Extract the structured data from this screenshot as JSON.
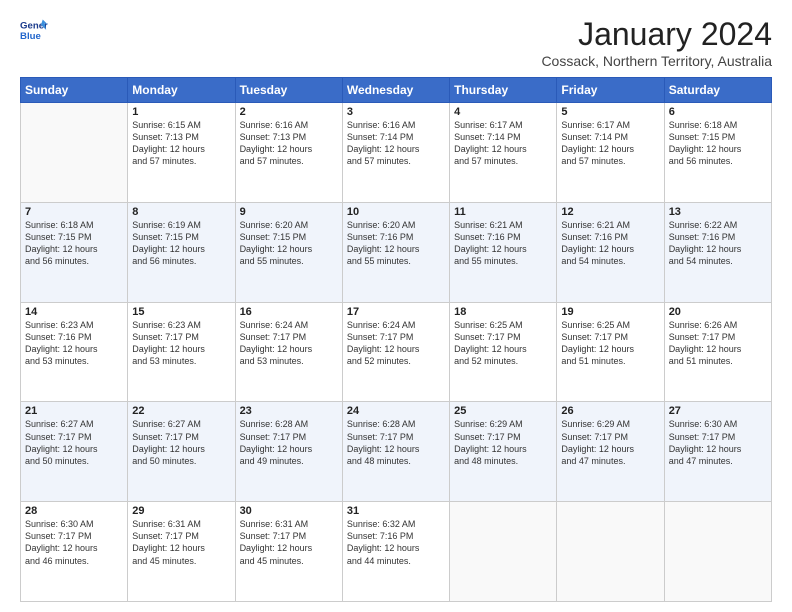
{
  "header": {
    "logo_line1": "General",
    "logo_line2": "Blue",
    "month_title": "January 2024",
    "subtitle": "Cossack, Northern Territory, Australia"
  },
  "weekdays": [
    "Sunday",
    "Monday",
    "Tuesday",
    "Wednesday",
    "Thursday",
    "Friday",
    "Saturday"
  ],
  "weeks": [
    [
      {
        "day": "",
        "sunrise": "",
        "sunset": "",
        "daylight": ""
      },
      {
        "day": "1",
        "sunrise": "6:15 AM",
        "sunset": "7:13 PM",
        "daylight": "12 hours and 57 minutes."
      },
      {
        "day": "2",
        "sunrise": "6:16 AM",
        "sunset": "7:13 PM",
        "daylight": "12 hours and 57 minutes."
      },
      {
        "day": "3",
        "sunrise": "6:16 AM",
        "sunset": "7:14 PM",
        "daylight": "12 hours and 57 minutes."
      },
      {
        "day": "4",
        "sunrise": "6:17 AM",
        "sunset": "7:14 PM",
        "daylight": "12 hours and 57 minutes."
      },
      {
        "day": "5",
        "sunrise": "6:17 AM",
        "sunset": "7:14 PM",
        "daylight": "12 hours and 57 minutes."
      },
      {
        "day": "6",
        "sunrise": "6:18 AM",
        "sunset": "7:15 PM",
        "daylight": "12 hours and 56 minutes."
      }
    ],
    [
      {
        "day": "7",
        "sunrise": "6:18 AM",
        "sunset": "7:15 PM",
        "daylight": "12 hours and 56 minutes."
      },
      {
        "day": "8",
        "sunrise": "6:19 AM",
        "sunset": "7:15 PM",
        "daylight": "12 hours and 56 minutes."
      },
      {
        "day": "9",
        "sunrise": "6:20 AM",
        "sunset": "7:15 PM",
        "daylight": "12 hours and 55 minutes."
      },
      {
        "day": "10",
        "sunrise": "6:20 AM",
        "sunset": "7:16 PM",
        "daylight": "12 hours and 55 minutes."
      },
      {
        "day": "11",
        "sunrise": "6:21 AM",
        "sunset": "7:16 PM",
        "daylight": "12 hours and 55 minutes."
      },
      {
        "day": "12",
        "sunrise": "6:21 AM",
        "sunset": "7:16 PM",
        "daylight": "12 hours and 54 minutes."
      },
      {
        "day": "13",
        "sunrise": "6:22 AM",
        "sunset": "7:16 PM",
        "daylight": "12 hours and 54 minutes."
      }
    ],
    [
      {
        "day": "14",
        "sunrise": "6:23 AM",
        "sunset": "7:16 PM",
        "daylight": "12 hours and 53 minutes."
      },
      {
        "day": "15",
        "sunrise": "6:23 AM",
        "sunset": "7:17 PM",
        "daylight": "12 hours and 53 minutes."
      },
      {
        "day": "16",
        "sunrise": "6:24 AM",
        "sunset": "7:17 PM",
        "daylight": "12 hours and 53 minutes."
      },
      {
        "day": "17",
        "sunrise": "6:24 AM",
        "sunset": "7:17 PM",
        "daylight": "12 hours and 52 minutes."
      },
      {
        "day": "18",
        "sunrise": "6:25 AM",
        "sunset": "7:17 PM",
        "daylight": "12 hours and 52 minutes."
      },
      {
        "day": "19",
        "sunrise": "6:25 AM",
        "sunset": "7:17 PM",
        "daylight": "12 hours and 51 minutes."
      },
      {
        "day": "20",
        "sunrise": "6:26 AM",
        "sunset": "7:17 PM",
        "daylight": "12 hours and 51 minutes."
      }
    ],
    [
      {
        "day": "21",
        "sunrise": "6:27 AM",
        "sunset": "7:17 PM",
        "daylight": "12 hours and 50 minutes."
      },
      {
        "day": "22",
        "sunrise": "6:27 AM",
        "sunset": "7:17 PM",
        "daylight": "12 hours and 50 minutes."
      },
      {
        "day": "23",
        "sunrise": "6:28 AM",
        "sunset": "7:17 PM",
        "daylight": "12 hours and 49 minutes."
      },
      {
        "day": "24",
        "sunrise": "6:28 AM",
        "sunset": "7:17 PM",
        "daylight": "12 hours and 48 minutes."
      },
      {
        "day": "25",
        "sunrise": "6:29 AM",
        "sunset": "7:17 PM",
        "daylight": "12 hours and 48 minutes."
      },
      {
        "day": "26",
        "sunrise": "6:29 AM",
        "sunset": "7:17 PM",
        "daylight": "12 hours and 47 minutes."
      },
      {
        "day": "27",
        "sunrise": "6:30 AM",
        "sunset": "7:17 PM",
        "daylight": "12 hours and 47 minutes."
      }
    ],
    [
      {
        "day": "28",
        "sunrise": "6:30 AM",
        "sunset": "7:17 PM",
        "daylight": "12 hours and 46 minutes."
      },
      {
        "day": "29",
        "sunrise": "6:31 AM",
        "sunset": "7:17 PM",
        "daylight": "12 hours and 45 minutes."
      },
      {
        "day": "30",
        "sunrise": "6:31 AM",
        "sunset": "7:17 PM",
        "daylight": "12 hours and 45 minutes."
      },
      {
        "day": "31",
        "sunrise": "6:32 AM",
        "sunset": "7:16 PM",
        "daylight": "12 hours and 44 minutes."
      },
      {
        "day": "",
        "sunrise": "",
        "sunset": "",
        "daylight": ""
      },
      {
        "day": "",
        "sunrise": "",
        "sunset": "",
        "daylight": ""
      },
      {
        "day": "",
        "sunrise": "",
        "sunset": "",
        "daylight": ""
      }
    ]
  ],
  "labels": {
    "sunrise_prefix": "Sunrise: ",
    "sunset_prefix": "Sunset: ",
    "daylight_prefix": "Daylight: "
  }
}
